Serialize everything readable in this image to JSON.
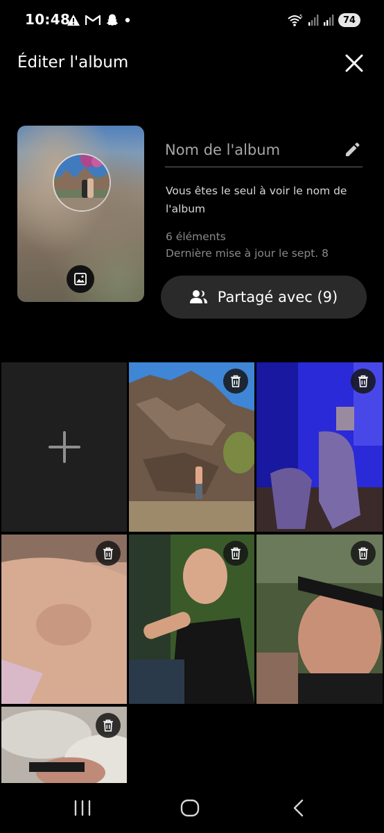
{
  "status_bar": {
    "time": "10:48",
    "battery": "74",
    "icons": [
      "warning-icon",
      "gmail-icon",
      "snapchat-icon",
      "dot-icon",
      "wifi-icon",
      "signal-icon",
      "signal-icon",
      "battery-icon"
    ]
  },
  "header": {
    "title": "Éditer l'album",
    "close_icon": "close-icon"
  },
  "cover": {
    "change_image_icon": "image-icon"
  },
  "album": {
    "name_placeholder": "Nom de l'album",
    "name_value": "",
    "privacy_note": "Vous êtes le seul à voir le nom de l'album",
    "item_count": "6 éléments",
    "last_updated": "Dernière mise à jour le sept. 8"
  },
  "share": {
    "label": "Partagé avec (9)",
    "icon": "people-icon"
  },
  "grid": {
    "add_icon": "plus-icon",
    "delete_icon": "trash-icon",
    "photo_count": 6
  },
  "nav": {
    "recents_icon": "recents-icon",
    "home_icon": "home-icon",
    "back_icon": "back-icon"
  },
  "colors": {
    "background": "#000000",
    "tile_add": "#1f1f1f",
    "button_bg": "#2a2a2a",
    "muted_text": "#8a8a8a"
  }
}
